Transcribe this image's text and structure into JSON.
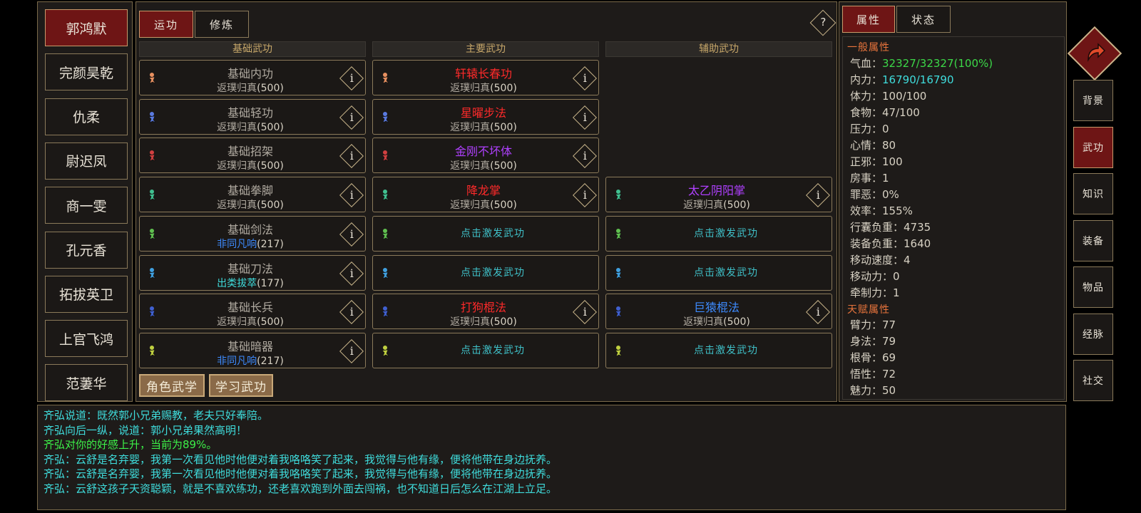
{
  "roster": [
    "郭鸿默",
    "完颜昊乾",
    "仇柔",
    "尉迟凤",
    "商一雯",
    "孔元香",
    "拓拔英卫",
    "上官飞鸿",
    "范萋华"
  ],
  "tabs": {
    "practice": "运功",
    "cultivate": "修炼"
  },
  "help_label": "?",
  "info_label": "i",
  "columns": {
    "basic": "基础武功",
    "main": "主要武功",
    "aux": "辅助武功"
  },
  "colors": {
    "rank_gray": "#b0aaa0",
    "rank_blue": "#3d8bff",
    "rank_cyan": "#3fdcdc",
    "skill_red": "#ff2a2a",
    "skill_purple": "#b040ff",
    "skill_blue": "#3d8bff",
    "empty_cyan": "#3fc0c8",
    "accent_red": "#6e1515"
  },
  "basic_skills": [
    {
      "name": "基础内功",
      "rank": "返璞归真",
      "level": "(500)",
      "rank_color": "#b0aaa0",
      "icon": "neigong-icon",
      "icon_color": "#e89060"
    },
    {
      "name": "基础轻功",
      "rank": "返璞归真",
      "level": "(500)",
      "rank_color": "#b0aaa0",
      "icon": "qinggong-icon",
      "icon_color": "#5a7ae0"
    },
    {
      "name": "基础招架",
      "rank": "返璞归真",
      "level": "(500)",
      "rank_color": "#b0aaa0",
      "icon": "parry-icon",
      "icon_color": "#d04040"
    },
    {
      "name": "基础拳脚",
      "rank": "返璞归真",
      "level": "(500)",
      "rank_color": "#b0aaa0",
      "icon": "fist-icon",
      "icon_color": "#40c090"
    },
    {
      "name": "基础剑法",
      "rank": "非同凡响",
      "level": "(217)",
      "rank_color": "#3d8bff",
      "icon": "sword-icon",
      "icon_color": "#60c050"
    },
    {
      "name": "基础刀法",
      "rank": "出类拔萃",
      "level": "(177)",
      "rank_color": "#3fdcdc",
      "icon": "blade-icon",
      "icon_color": "#40a0e0"
    },
    {
      "name": "基础长兵",
      "rank": "返璞归真",
      "level": "(500)",
      "rank_color": "#b0aaa0",
      "icon": "polearm-icon",
      "icon_color": "#4060d0"
    },
    {
      "name": "基础暗器",
      "rank": "非同凡响",
      "level": "(217)",
      "rank_color": "#3d8bff",
      "icon": "hidden-weapon-icon",
      "icon_color": "#c0d040"
    }
  ],
  "main_skills": [
    {
      "name": "轩辕长春功",
      "name_color": "#ff2a2a",
      "rank": "返璞归真",
      "level": "(500)"
    },
    {
      "name": "星曜步法",
      "name_color": "#ff2a2a",
      "rank": "返璞归真",
      "level": "(500)"
    },
    {
      "name": "金刚不坏体",
      "name_color": "#b040ff",
      "rank": "返璞归真",
      "level": "(500)"
    },
    {
      "name": "降龙掌",
      "name_color": "#ff2a2a",
      "rank": "返璞归真",
      "level": "(500)"
    },
    {
      "empty": "点击激发武功"
    },
    {
      "empty": "点击激发武功"
    },
    {
      "name": "打狗棍法",
      "name_color": "#ff2a2a",
      "rank": "返璞归真",
      "level": "(500)"
    },
    {
      "empty": "点击激发武功"
    }
  ],
  "aux_skills": [
    null,
    null,
    null,
    {
      "name": "太乙阴阳掌",
      "name_color": "#b040ff",
      "rank": "返璞归真",
      "level": "(500)"
    },
    {
      "empty": "点击激发武功"
    },
    {
      "empty": "点击激发武功"
    },
    {
      "name": "巨猿棍法",
      "name_color": "#3d8bff",
      "rank": "返璞归真",
      "level": "(500)"
    },
    {
      "empty": "点击激发武功"
    }
  ],
  "bottom_buttons": {
    "character_arts": "角色武学",
    "learn_arts": "学习武功"
  },
  "attr_tabs": {
    "attributes": "属性",
    "status": "状态"
  },
  "attributes": {
    "general_header": "一般属性",
    "general": [
      {
        "label": "气血：",
        "value": "32327/32327(100%)",
        "color": "#3cd848"
      },
      {
        "label": "内力：",
        "value": "16790/16790",
        "color": "#3fdcdc"
      },
      {
        "label": "体力：",
        "value": "100/100"
      },
      {
        "label": "食物：",
        "value": "47/100"
      },
      {
        "label": "压力：",
        "value": "0"
      },
      {
        "label": "心情：",
        "value": "80"
      },
      {
        "label": "正邪：",
        "value": "100"
      },
      {
        "label": "房事：",
        "value": "1"
      },
      {
        "label": "罪恶：",
        "value": "0%"
      },
      {
        "label": "效率：",
        "value": "155%"
      },
      {
        "label": "行囊负重：",
        "value": "4735"
      },
      {
        "label": "装备负重：",
        "value": "1640"
      },
      {
        "label": "移动速度：",
        "value": "4"
      },
      {
        "label": "移动力：",
        "value": "0"
      },
      {
        "label": "牵制力：",
        "value": "1"
      }
    ],
    "talent_header": "天赋属性",
    "talent": [
      {
        "label": "臂力：",
        "value": "77"
      },
      {
        "label": "身法：",
        "value": "79"
      },
      {
        "label": "根骨：",
        "value": "69"
      },
      {
        "label": "悟性：",
        "value": "72"
      },
      {
        "label": "魅力：",
        "value": "50"
      }
    ]
  },
  "nav": [
    "背景",
    "武功",
    "知识",
    "装备",
    "物品",
    "经脉",
    "社交"
  ],
  "nav_active": "武功",
  "log": [
    {
      "text": "齐弘说道：既然郭小兄弟赐教，老夫只好奉陪。",
      "color": "#3fdcdc"
    },
    {
      "text": "齐弘向后一纵，说道：郭小兄弟果然高明！",
      "color": "#3fdcdc"
    },
    {
      "text": "齐弘对你的好感上升，当前为89%。",
      "color": "#3cf048"
    },
    {
      "text": "齐弘：云舒是名弃婴，我第一次看见他时他便对着我咯咯笑了起来，我觉得与他有缘，便将他带在身边抚养。",
      "color": "#3fdcdc"
    },
    {
      "text": "齐弘：云舒是名弃婴，我第一次看见他时他便对着我咯咯笑了起来，我觉得与他有缘，便将他带在身边抚养。",
      "color": "#3fdcdc"
    },
    {
      "text": "齐弘：云舒这孩子天资聪颖，就是不喜欢练功，还老喜欢跑到外面去闯祸，也不知道日后怎么在江湖上立足。",
      "color": "#3fdcdc"
    }
  ]
}
